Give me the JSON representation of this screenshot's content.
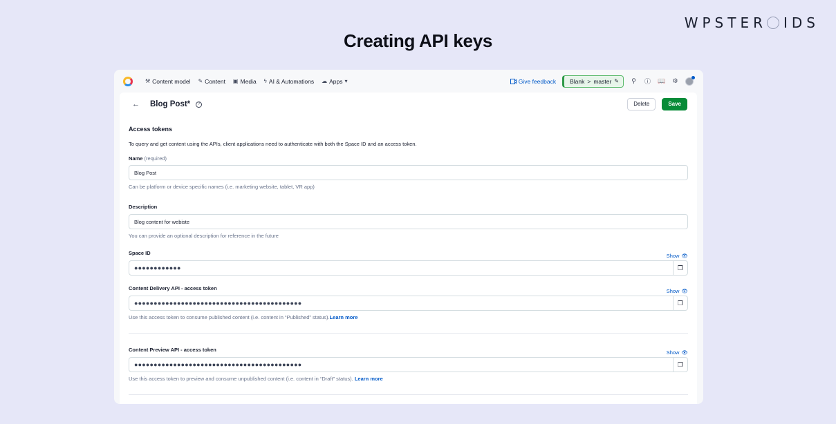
{
  "brand": {
    "left": "WPSTER",
    "right": "IDS"
  },
  "headline": "Creating API keys",
  "topnav": {
    "items": [
      {
        "icon": "wrench-icon",
        "glyph": "⚒",
        "label": "Content model"
      },
      {
        "icon": "pencil-icon",
        "glyph": "✎",
        "label": "Content"
      },
      {
        "icon": "image-icon",
        "glyph": "▣",
        "label": "Media"
      },
      {
        "icon": "lightning-icon",
        "glyph": "ϟ",
        "label": "AI & Automations"
      },
      {
        "icon": "cloud-icon",
        "glyph": "☁",
        "label": "Apps"
      }
    ],
    "apps_chevron": "▾",
    "feedback": "Give feedback",
    "env_space": "Blank",
    "env_separator": ">",
    "env_name": "master"
  },
  "header": {
    "title": "Blog Post*",
    "delete_label": "Delete",
    "save_label": "Save"
  },
  "form": {
    "section_title": "Access tokens",
    "intro": "To query and get content using the APIs, client applications need to authenticate with both the Space ID and an access token.",
    "name_label": "Name",
    "name_required": "(required)",
    "name_value": "Blog Post",
    "name_hint": "Can be platform or device specific names (i.e. marketing website, tablet, VR app)",
    "description_label": "Description",
    "description_value": "Blog content for webiste",
    "description_hint": "You can provide an optional description for reference in the future",
    "space_id_label": "Space ID",
    "space_id_value": "●●●●●●●●●●●●",
    "show_label": "Show",
    "cda_label": "Content Delivery API - access token",
    "cda_value": "●●●●●●●●●●●●●●●●●●●●●●●●●●●●●●●●●●●●●●●●●●●",
    "cda_hint": "Use this access token to consume published content (i.e. content in “Published” status).",
    "learn_more": "Learn more",
    "cpa_label": "Content Preview API - access token",
    "cpa_value": "●●●●●●●●●●●●●●●●●●●●●●●●●●●●●●●●●●●●●●●●●●●",
    "cpa_hint": "Use this access token to preview and consume unpublished content (i.e. content in “Draft” status). "
  }
}
